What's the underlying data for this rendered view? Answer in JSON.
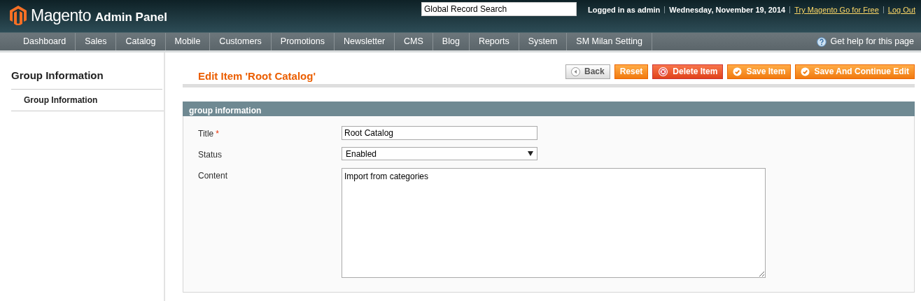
{
  "header": {
    "logo_text": "Magento",
    "logo_suffix": "Admin Panel",
    "search": {
      "value": "Global Record Search"
    },
    "user_links": [
      {
        "text": "Logged in as admin",
        "kind": "text"
      },
      {
        "text": "Wednesday, November 19, 2014",
        "kind": "text"
      },
      {
        "text": "Try Magento Go for Free",
        "kind": "link"
      },
      {
        "text": "Log Out",
        "kind": "link"
      }
    ]
  },
  "nav": {
    "items": [
      "Dashboard",
      "Sales",
      "Catalog",
      "Mobile",
      "Customers",
      "Promotions",
      "Newsletter",
      "CMS",
      "Blog",
      "Reports",
      "System",
      "SM Milan Setting"
    ],
    "help": "Get help for this page"
  },
  "sidebar": {
    "title": "Group Information",
    "items": [
      {
        "label": "Group Information",
        "selected": true
      }
    ]
  },
  "page": {
    "title": "Edit Item 'Root Catalog'",
    "buttons": [
      {
        "label": "Back",
        "kind": "back"
      },
      {
        "label": "Reset",
        "kind": "reset"
      },
      {
        "label": "Delete Item",
        "kind": "delete"
      },
      {
        "label": "Save Item",
        "kind": "save"
      },
      {
        "label": "Save And Continue Edit",
        "kind": "save"
      }
    ],
    "fieldset": {
      "legend": "group information",
      "fields": [
        {
          "label": "Title",
          "required_mark": "*",
          "kind": "text",
          "value": "Root Catalog"
        },
        {
          "label": "Status",
          "kind": "select",
          "value": "Enabled"
        },
        {
          "label": "Content",
          "kind": "textarea",
          "value": "Import from categories"
        }
      ]
    }
  }
}
